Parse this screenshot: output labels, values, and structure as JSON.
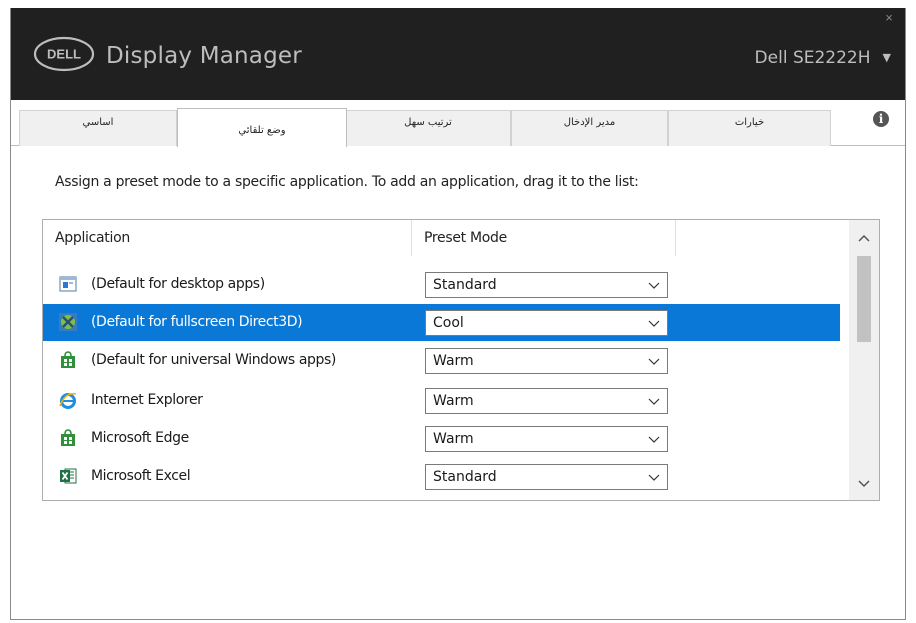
{
  "window": {
    "logo_text": "DELL",
    "title": "Display Manager",
    "close_glyph": "×",
    "monitor": "Dell SE2222H",
    "monitor_caret": "▼"
  },
  "tabs": [
    {
      "label": "اساسي",
      "active": false
    },
    {
      "label": "وضع تلقائي",
      "active": true
    },
    {
      "label": "ترتيب سهل",
      "active": false
    },
    {
      "label": "مدير الإدخال",
      "active": false
    },
    {
      "label": "خيارات",
      "active": false
    }
  ],
  "info_glyph": "i",
  "instruction": "Assign a preset mode to a specific application.  To add an application, drag it to the list:",
  "table": {
    "columns": [
      "Application",
      "Preset Mode"
    ],
    "rows": [
      {
        "name": "(Default for desktop apps)",
        "mode": "Standard",
        "icon": "desktop-app-icon",
        "selected": false
      },
      {
        "name": "(Default for fullscreen Direct3D)",
        "mode": "Cool",
        "icon": "direct3d-icon",
        "selected": true
      },
      {
        "name": "(Default for universal Windows apps)",
        "mode": "Warm",
        "icon": "store-icon",
        "selected": false
      },
      {
        "name": "Internet Explorer",
        "mode": "Warm",
        "icon": "internet-explorer-icon",
        "selected": false
      },
      {
        "name": "Microsoft Edge",
        "mode": "Warm",
        "icon": "store-icon",
        "selected": false
      },
      {
        "name": "Microsoft Excel",
        "mode": "Standard",
        "icon": "excel-icon",
        "selected": false
      }
    ]
  },
  "colors": {
    "titlebar": "#202020",
    "selection": "#0a78d7",
    "accent_green": "#2f8f3a",
    "excel_green": "#1e7145"
  }
}
